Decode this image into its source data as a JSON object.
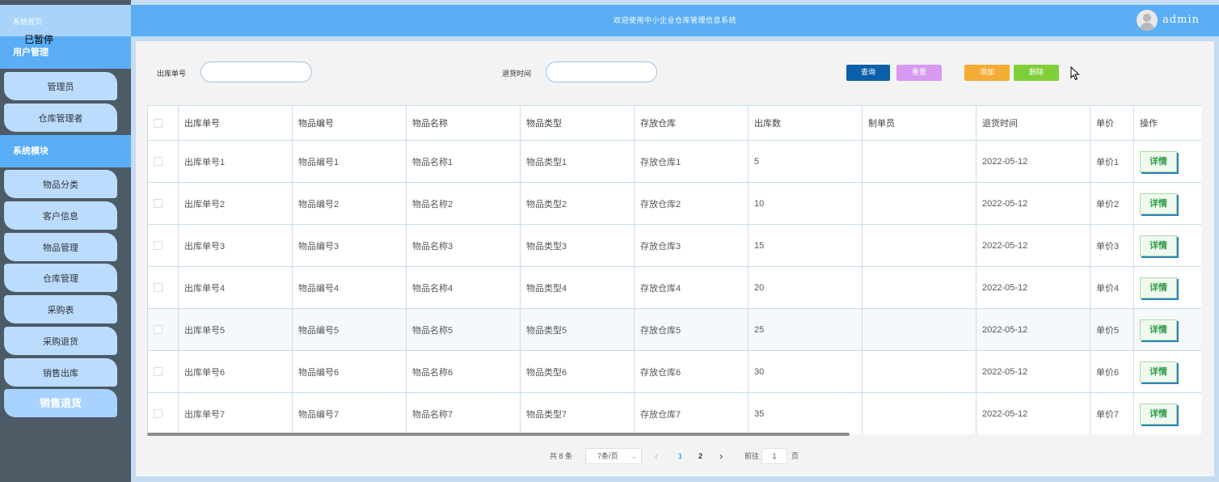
{
  "sidebar": {
    "home": "系统首页",
    "paused": "已暂停",
    "user_section": "用户管理",
    "user_items": [
      "管理员",
      "仓库管理者"
    ],
    "system_section": "系统模块",
    "system_items": [
      "物品分类",
      "客户信息",
      "物品管理",
      "仓库管理",
      "采购表",
      "采购退货",
      "销售出库",
      "销售退货"
    ]
  },
  "header": {
    "title": "欢迎使用中小企业仓库管理信息系统",
    "user": "admin"
  },
  "search": {
    "field1_label": "出库单号",
    "field1_value": "",
    "field2_label": "退货时间",
    "field2_value": ""
  },
  "toolbar": {
    "query": "查询",
    "reset": "重置",
    "add": "添加",
    "delete": "删除"
  },
  "colors": {
    "query": "#0b5fa8",
    "reset": "#d79af0",
    "add": "#f3ac35",
    "delete": "#7fcf3b"
  },
  "table": {
    "columns": [
      "出库单号",
      "物品编号",
      "物品名称",
      "物品类型",
      "存放仓库",
      "出库数",
      "制单员",
      "退货时间",
      "单价",
      "操作"
    ],
    "action_label": "详情",
    "rows": [
      [
        "出库单号1",
        "物品编号1",
        "物品名称1",
        "物品类型1",
        "存放仓库1",
        "5",
        "",
        "2022-05-12",
        "单价1"
      ],
      [
        "出库单号2",
        "物品编号2",
        "物品名称2",
        "物品类型2",
        "存放仓库2",
        "10",
        "",
        "2022-05-12",
        "单价2"
      ],
      [
        "出库单号3",
        "物品编号3",
        "物品名称3",
        "物品类型3",
        "存放仓库3",
        "15",
        "",
        "2022-05-12",
        "单价3"
      ],
      [
        "出库单号4",
        "物品编号4",
        "物品名称4",
        "物品类型4",
        "存放仓库4",
        "20",
        "",
        "2022-05-12",
        "单价4"
      ],
      [
        "出库单号5",
        "物品编号5",
        "物品名称5",
        "物品类型5",
        "存放仓库5",
        "25",
        "",
        "2022-05-12",
        "单价5"
      ],
      [
        "出库单号6",
        "物品编号6",
        "物品名称6",
        "物品类型6",
        "存放仓库6",
        "30",
        "",
        "2022-05-12",
        "单价6"
      ],
      [
        "出库单号7",
        "物品编号7",
        "物品名称7",
        "物品类型7",
        "存放仓库7",
        "35",
        "",
        "2022-05-12",
        "单价7"
      ]
    ]
  },
  "pagination": {
    "total": "共 8 条",
    "page_size": "7条/页",
    "prev": "‹",
    "pages": [
      "1",
      "2"
    ],
    "next": "›",
    "goto_label": "前往",
    "goto_value": "1",
    "goto_suffix": "页"
  }
}
